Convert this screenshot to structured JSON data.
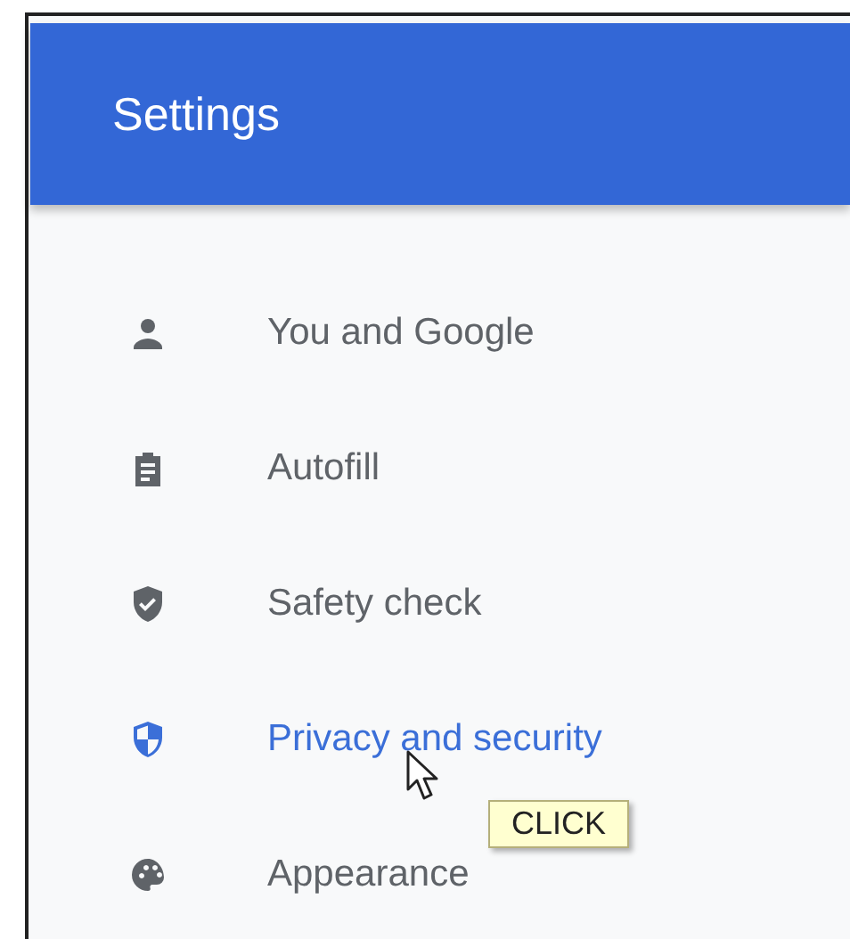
{
  "header": {
    "title": "Settings"
  },
  "menu": [
    {
      "label": "You and Google",
      "kind": "person",
      "selected": false
    },
    {
      "label": "Autofill",
      "kind": "clipboard",
      "selected": false
    },
    {
      "label": "Safety check",
      "kind": "shield-check",
      "selected": false
    },
    {
      "label": "Privacy and security",
      "kind": "shield",
      "selected": true
    },
    {
      "label": "Appearance",
      "kind": "palette",
      "selected": false
    }
  ],
  "cursor": {
    "tooltip": "CLICK"
  }
}
